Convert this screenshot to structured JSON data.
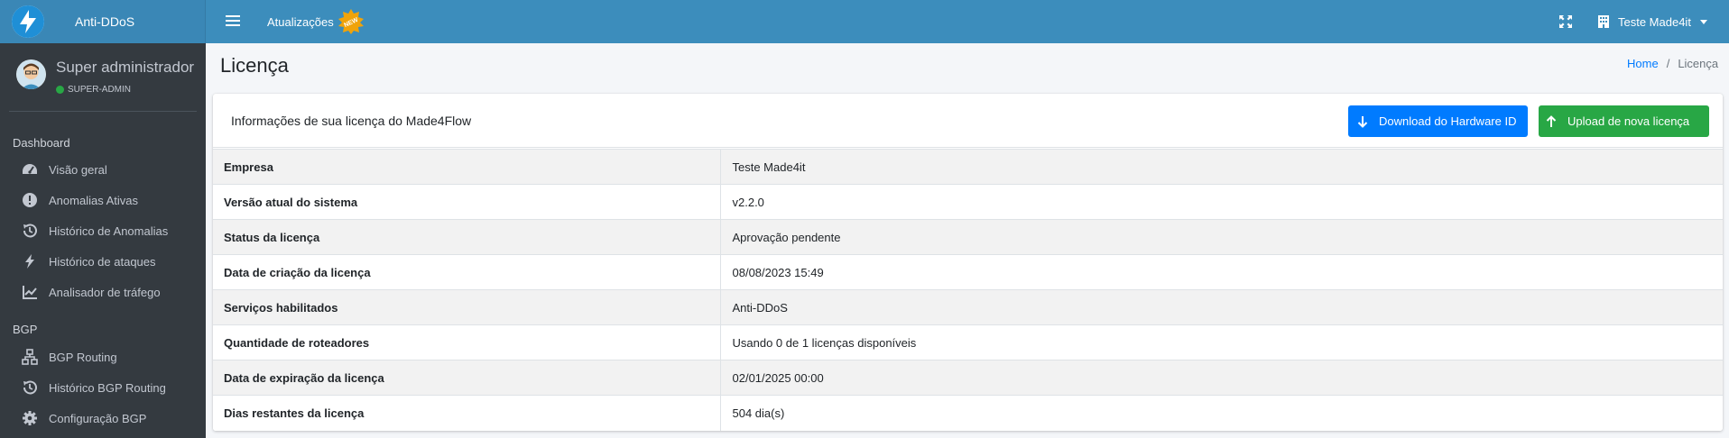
{
  "brand": {
    "name": "Anti-DDoS",
    "logo_icon": "bolt-logo-icon"
  },
  "topbar": {
    "updates_label": "Atualizações",
    "new_badge": "NEW",
    "user_label": "Teste Made4it",
    "colors": {
      "navbar": "#3c8dbc",
      "badge": "#f0a30a"
    }
  },
  "sidebar": {
    "user_name": "Super administrador",
    "user_role": "SUPER-ADMIN",
    "sections": [
      {
        "header": "Dashboard",
        "items": [
          {
            "label": "Visão geral",
            "icon": "tachometer-icon"
          },
          {
            "label": "Anomalias Ativas",
            "icon": "exclamation-circle-icon"
          },
          {
            "label": "Histórico de Anomalias",
            "icon": "history-icon"
          },
          {
            "label": "Histórico de ataques",
            "icon": "bolt-icon"
          },
          {
            "label": "Analisador de tráfego",
            "icon": "chart-line-icon"
          }
        ]
      },
      {
        "header": "BGP",
        "items": [
          {
            "label": "BGP Routing",
            "icon": "sitemap-icon"
          },
          {
            "label": "Histórico BGP Routing",
            "icon": "history-icon"
          },
          {
            "label": "Configuração BGP",
            "icon": "gear-icon"
          }
        ]
      }
    ]
  },
  "page": {
    "title": "Licença",
    "breadcrumb": {
      "home": "Home",
      "separator": "/",
      "current": "Licença"
    }
  },
  "card": {
    "title": "Informações de sua licença do Made4Flow",
    "download_label": "Download do Hardware ID",
    "upload_label": "Upload de nova licença",
    "rows": [
      {
        "key": "Empresa",
        "value": "Teste Made4it"
      },
      {
        "key": "Versão atual do sistema",
        "value": "v2.2.0"
      },
      {
        "key": "Status da licença",
        "value": "Aprovação pendente"
      },
      {
        "key": "Data de criação da licença",
        "value": "08/08/2023 15:49"
      },
      {
        "key": "Serviços habilitados",
        "value": "Anti-DDoS"
      },
      {
        "key": "Quantidade de roteadores",
        "value": "Usando 0 de 1 licenças disponíveis"
      },
      {
        "key": "Data de expiração da licença",
        "value": "02/01/2025 00:00"
      },
      {
        "key": "Dias restantes da licença",
        "value": "504 dia(s)"
      }
    ]
  }
}
